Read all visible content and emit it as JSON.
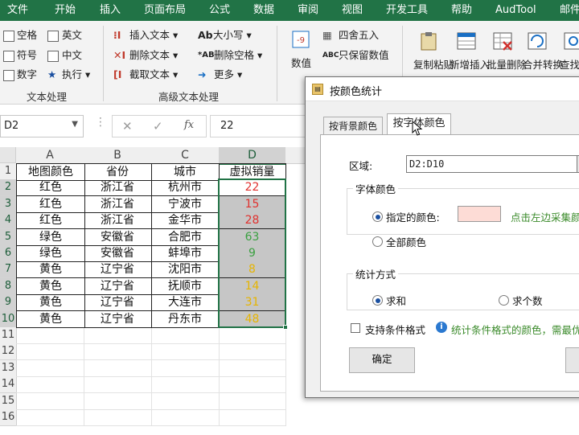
{
  "ribbon_tabs": [
    "文件",
    "开始",
    "插入",
    "页面布局",
    "公式",
    "数据",
    "审阅",
    "视图",
    "开发工具",
    "帮助",
    "AudTool",
    "邮件"
  ],
  "text_group": {
    "items": [
      "空格",
      "英文",
      "符号",
      "中文",
      "数字",
      "执行"
    ],
    "label": "文本处理"
  },
  "advanced_group": {
    "items": [
      "插入文本",
      "删除文本",
      "截取文本",
      "大小写",
      "删除空格",
      "更多"
    ],
    "label": "高级文本处理"
  },
  "number_group": {
    "big": "数值",
    "items": [
      "四舍五入",
      "只保留数值"
    ]
  },
  "right_buttons": [
    "复制粘贴",
    "新增插入",
    "批量删除",
    "合并转换",
    "查找"
  ],
  "formula_bar": {
    "name_box": "D2",
    "value": "22",
    "fx": "fx"
  },
  "columns": [
    "A",
    "B",
    "C",
    "D"
  ],
  "row_numbers": [
    "1",
    "2",
    "3",
    "4",
    "5",
    "6",
    "7",
    "8",
    "9",
    "10",
    "11",
    "12",
    "13",
    "14",
    "15",
    "16"
  ],
  "table": {
    "headers": [
      "地图颜色",
      "省份",
      "城市",
      "虚拟销量"
    ],
    "rows": [
      {
        "color": "红色",
        "province": "浙江省",
        "city": "杭州市",
        "sales": "22",
        "font_color": "#e0312e"
      },
      {
        "color": "红色",
        "province": "浙江省",
        "city": "宁波市",
        "sales": "15",
        "font_color": "#e0312e"
      },
      {
        "color": "红色",
        "province": "浙江省",
        "city": "金华市",
        "sales": "28",
        "font_color": "#e0312e"
      },
      {
        "color": "绿色",
        "province": "安徽省",
        "city": "合肥市",
        "sales": "63",
        "font_color": "#3aa040"
      },
      {
        "color": "绿色",
        "province": "安徽省",
        "city": "蚌埠市",
        "sales": "9",
        "font_color": "#3aa040"
      },
      {
        "color": "黄色",
        "province": "辽宁省",
        "city": "沈阳市",
        "sales": "8",
        "font_color": "#e6b400"
      },
      {
        "color": "黄色",
        "province": "辽宁省",
        "city": "抚顺市",
        "sales": "14",
        "font_color": "#e6b400"
      },
      {
        "color": "黄色",
        "province": "辽宁省",
        "city": "大连市",
        "sales": "31",
        "font_color": "#e6b400"
      },
      {
        "color": "黄色",
        "province": "辽宁省",
        "city": "丹东市",
        "sales": "48",
        "font_color": "#e6b400"
      }
    ]
  },
  "dialog": {
    "title": "按颜色统计",
    "tabs": [
      "按背景颜色",
      "按字体颜色"
    ],
    "range_label": "区域:",
    "range_value": "D2:D10",
    "font_color_group": "字体颜色",
    "opt_specified": "指定的颜色:",
    "swatch_color": "#fddcd6",
    "pick_hint": "点击左边采集颜色",
    "opt_all": "全部颜色",
    "stat_group": "统计方式",
    "opt_sum": "求和",
    "opt_count": "求个数",
    "cond_format": "支持条件格式",
    "cond_hint": "统计条件格式的颜色，需最优",
    "ok": "确定"
  },
  "colors": {
    "excel_green": "#217346",
    "selection": "#c6c6c6",
    "accent_blue": "#1a4fa0"
  }
}
